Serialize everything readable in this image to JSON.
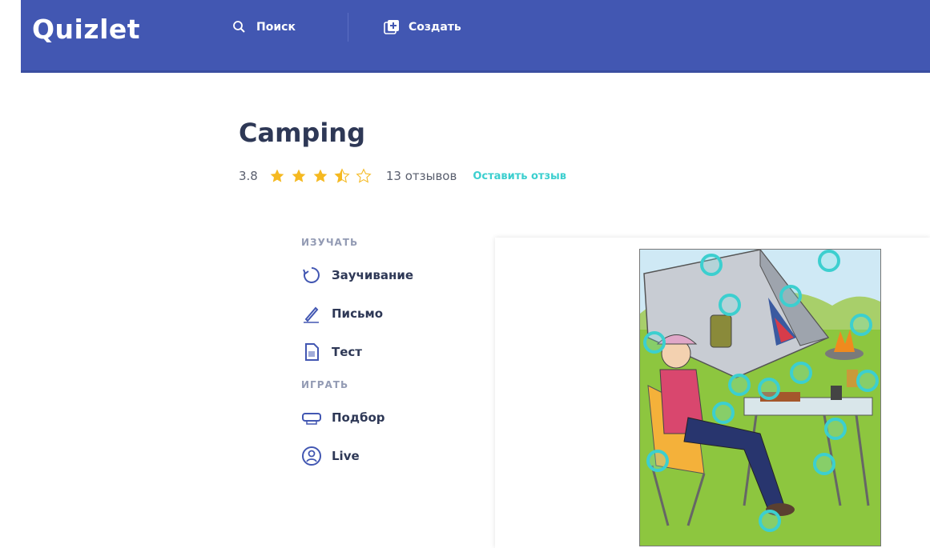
{
  "header": {
    "logo": "Quizlet",
    "search_label": "Поиск",
    "create_label": "Создать",
    "background_color": "#4257b2"
  },
  "set": {
    "title": "Camping",
    "rating": "3.8",
    "rating_value": 3.5,
    "stars_max": 5,
    "reviews_count": "13 отзывов",
    "leave_review": "Оставить отзыв"
  },
  "menu": {
    "study_label": "ИЗУЧАТЬ",
    "play_label": "ИГРАТЬ",
    "study_items": [
      {
        "label": "Заучивание",
        "icon": "learn-cycle-icon"
      },
      {
        "label": "Письмо",
        "icon": "write-pen-icon"
      },
      {
        "label": "Тест",
        "icon": "test-document-icon"
      }
    ],
    "play_items": [
      {
        "label": "Подбор",
        "icon": "match-icon"
      },
      {
        "label": "Live",
        "icon": "live-person-icon"
      }
    ]
  },
  "diagram": {
    "image": "camping-scene-illustration",
    "marker_count": 20,
    "accent_color": "#3ccfcf"
  }
}
